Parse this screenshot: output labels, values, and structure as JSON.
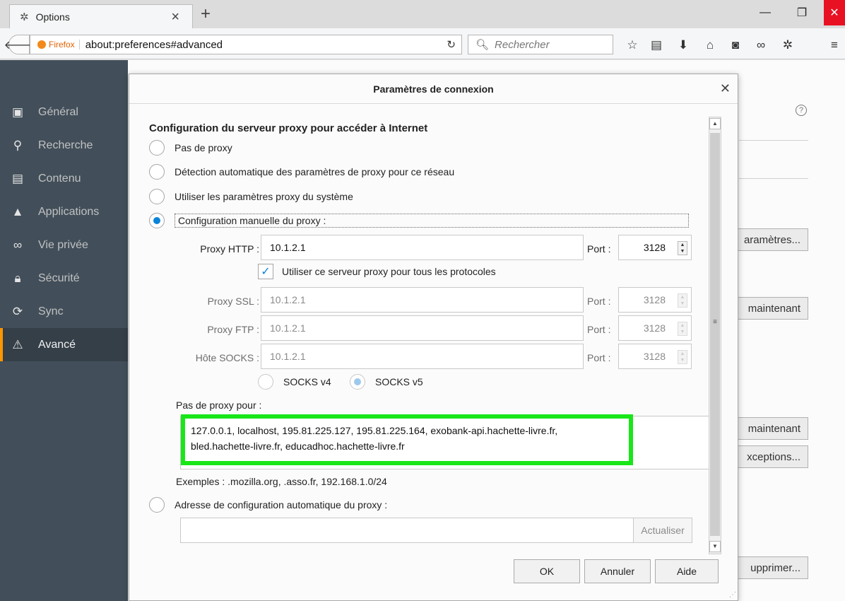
{
  "tab": {
    "title": "Options",
    "close": "×",
    "new_tab": "+"
  },
  "window": {
    "minimize": "—",
    "maximize": "❐",
    "close": "✕"
  },
  "nav": {
    "identity_label": "Firefox",
    "url": "about:preferences#advanced",
    "search_placeholder": "Rechercher"
  },
  "sidebar": {
    "items": [
      {
        "label": "Général",
        "icon": "general-icon"
      },
      {
        "label": "Recherche",
        "icon": "search-icon"
      },
      {
        "label": "Contenu",
        "icon": "content-icon"
      },
      {
        "label": "Applications",
        "icon": "applications-icon"
      },
      {
        "label": "Vie privée",
        "icon": "privacy-mask-icon"
      },
      {
        "label": "Sécurité",
        "icon": "lock-icon"
      },
      {
        "label": "Sync",
        "icon": "sync-icon"
      },
      {
        "label": "Avancé",
        "icon": "wizard-hat-icon"
      }
    ],
    "active": "Avancé"
  },
  "background_buttons": {
    "settings": "aramètres...",
    "now1": "maintenant",
    "now2": "maintenant",
    "exceptions": "xceptions...",
    "delete": "upprimer..."
  },
  "dialog": {
    "title": "Paramètres de connexion",
    "section_title": "Configuration du serveur proxy pour accéder à Internet",
    "options": {
      "no_proxy": "Pas de proxy",
      "auto_detect": "Détection automatique des paramètres de proxy pour ce réseau",
      "system": "Utiliser les paramètres proxy du système",
      "manual": "Configuration manuelle du proxy :",
      "auto_url": "Adresse de configuration automatique du proxy :"
    },
    "selected_option": "manual",
    "http": {
      "label": "Proxy HTTP :",
      "host": "10.1.2.1",
      "port_label": "Port :",
      "port": "3128"
    },
    "share_all": {
      "label": "Utiliser ce serveur proxy pour tous les protocoles",
      "checked": true
    },
    "ssl": {
      "label": "Proxy SSL :",
      "host": "10.1.2.1",
      "port_label": "Port :",
      "port": "3128"
    },
    "ftp": {
      "label": "Proxy FTP :",
      "host": "10.1.2.1",
      "port_label": "Port :",
      "port": "3128"
    },
    "socks": {
      "label": "Hôte SOCKS :",
      "host": "10.1.2.1",
      "port_label": "Port :",
      "port": "3128"
    },
    "socks_v4": "SOCKS v4",
    "socks_v5": "SOCKS v5",
    "socks_selected": "v5",
    "no_proxy_for_label": "Pas de proxy pour :",
    "no_proxy_for_line1": "127.0.0.1, localhost, 195.81.225.127, 195.81.225.164, exobank-api.hachette-livre.fr,",
    "no_proxy_for_line2": "bled.hachette-livre.fr, educadhoc.hachette-livre.fr",
    "examples": "Exemples : .mozilla.org, .asso.fr, 192.168.1.0/24",
    "refresh": "Actualiser",
    "ok": "OK",
    "cancel": "Annuler",
    "help": "Aide"
  },
  "colors": {
    "accent": "#0a84d8",
    "highlight": "#19e619",
    "sidebar_bg": "#424f5a",
    "active_marker": "#ff9500"
  }
}
